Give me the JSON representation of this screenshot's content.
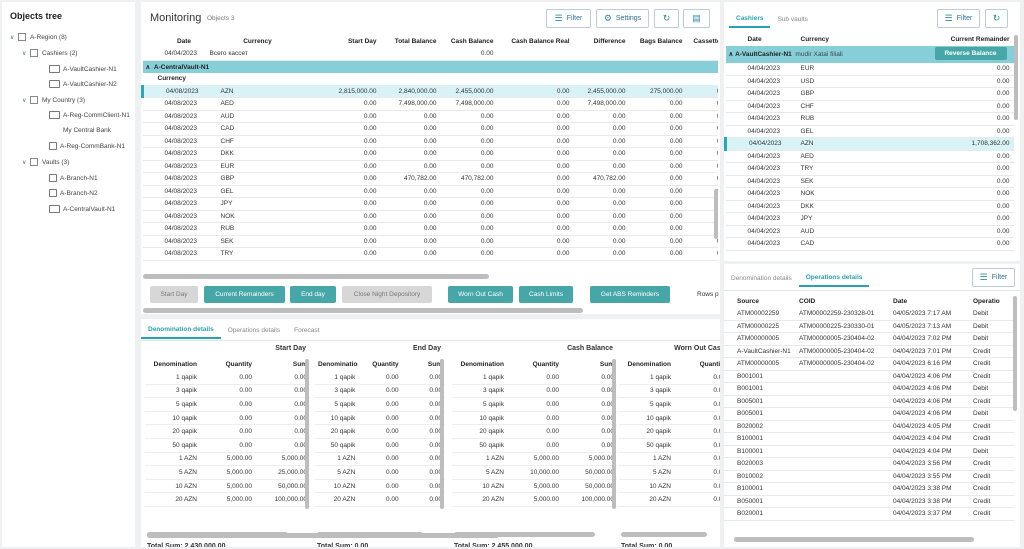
{
  "tree": {
    "title": "Objects tree",
    "nodes": [
      {
        "label": "A-Region (8)"
      },
      {
        "label": "Cashiers (2)"
      },
      {
        "label": "A-VaultCashier-N1"
      },
      {
        "label": "A-VaultCashier-N2"
      },
      {
        "label": "My Country (3)"
      },
      {
        "label": "A-Reg-CommClient-N1"
      },
      {
        "label": "My Central Bank"
      },
      {
        "label": "A-Reg-CommBank-N1"
      },
      {
        "label": "Vaults (3)"
      },
      {
        "label": "A-Branch-N1"
      },
      {
        "label": "A-Branch-N2"
      },
      {
        "label": "A-CentralVault-N1"
      }
    ]
  },
  "monitoring": {
    "title": "Monitoring",
    "subtitle": "Objects 3",
    "filter_label": "Filter",
    "settings_label": "Settings",
    "columns": [
      "Date",
      "Currency",
      "Start Day",
      "Total Balance",
      "Cash Balance",
      "Cash Balance Real",
      "Difference",
      "Bags Balance",
      "Cassette"
    ],
    "summary": {
      "date": "04/04/2023",
      "label": "Всего кассет",
      "cash_balance": "0.00"
    },
    "group_label": "A-CentralVault-N1",
    "sub_header": "Currency",
    "rows": [
      {
        "date": "04/08/2023",
        "currency": "AZN",
        "start": "2,815,000.00",
        "total": "2,840,000.00",
        "cash": "2,455,000.00",
        "real": "0.00",
        "diff": "2,455,000.00",
        "bags": "275,000.00",
        "cass": "0"
      },
      {
        "date": "04/08/2023",
        "currency": "AED",
        "start": "0.00",
        "total": "7,498,000.00",
        "cash": "7,498,000.00",
        "real": "0.00",
        "diff": "7,498,000.00",
        "bags": "0.00",
        "cass": "0"
      },
      {
        "date": "04/08/2023",
        "currency": "AUD",
        "start": "0.00",
        "total": "0.00",
        "cash": "0.00",
        "real": "0.00",
        "diff": "0.00",
        "bags": "0.00",
        "cass": "0"
      },
      {
        "date": "04/08/2023",
        "currency": "CAD",
        "start": "0.00",
        "total": "0.00",
        "cash": "0.00",
        "real": "0.00",
        "diff": "0.00",
        "bags": "0.00",
        "cass": "0"
      },
      {
        "date": "04/08/2023",
        "currency": "CHF",
        "start": "0.00",
        "total": "0.00",
        "cash": "0.00",
        "real": "0.00",
        "diff": "0.00",
        "bags": "0.00",
        "cass": "0"
      },
      {
        "date": "04/08/2023",
        "currency": "DKK",
        "start": "0.00",
        "total": "0.00",
        "cash": "0.00",
        "real": "0.00",
        "diff": "0.00",
        "bags": "0.00",
        "cass": "0"
      },
      {
        "date": "04/08/2023",
        "currency": "EUR",
        "start": "0.00",
        "total": "0.00",
        "cash": "0.00",
        "real": "0.00",
        "diff": "0.00",
        "bags": "0.00",
        "cass": "0"
      },
      {
        "date": "04/08/2023",
        "currency": "GBP",
        "start": "0.00",
        "total": "470,782.00",
        "cash": "470,782.00",
        "real": "0.00",
        "diff": "470,782.00",
        "bags": "0.00",
        "cass": "0"
      },
      {
        "date": "04/08/2023",
        "currency": "GEL",
        "start": "0.00",
        "total": "0.00",
        "cash": "0.00",
        "real": "0.00",
        "diff": "0.00",
        "bags": "0.00",
        "cass": "0"
      },
      {
        "date": "04/08/2023",
        "currency": "JPY",
        "start": "0.00",
        "total": "0.00",
        "cash": "0.00",
        "real": "0.00",
        "diff": "0.00",
        "bags": "0.00",
        "cass": "0"
      },
      {
        "date": "04/08/2023",
        "currency": "NOK",
        "start": "0.00",
        "total": "0.00",
        "cash": "0.00",
        "real": "0.00",
        "diff": "0.00",
        "bags": "0.00",
        "cass": "0"
      },
      {
        "date": "04/08/2023",
        "currency": "RUB",
        "start": "0.00",
        "total": "0.00",
        "cash": "0.00",
        "real": "0.00",
        "diff": "0.00",
        "bags": "0.00",
        "cass": "0"
      },
      {
        "date": "04/08/2023",
        "currency": "SEK",
        "start": "0.00",
        "total": "0.00",
        "cash": "0.00",
        "real": "0.00",
        "diff": "0.00",
        "bags": "0.00",
        "cass": "0"
      },
      {
        "date": "04/08/2023",
        "currency": "TRY",
        "start": "0.00",
        "total": "0.00",
        "cash": "0.00",
        "real": "0.00",
        "diff": "0.00",
        "bags": "0.00",
        "cass": "0"
      }
    ],
    "actions": [
      "Start Day",
      "Current Remainders",
      "End day",
      "Close Night Depository",
      "Worn Out Cash",
      "Cash Limits",
      "Get ABS Reminders"
    ],
    "rows_per_page_label": "Rows p"
  },
  "denomination": {
    "tabs": [
      "Denomination details",
      "Operations details",
      "Forecast"
    ],
    "col_headers": [
      "Denomination",
      "Quantity",
      "Sum"
    ],
    "blocks": [
      {
        "title": "Start Day",
        "total": "Total Sum: 2,430,000.00",
        "rows": [
          [
            "1 qapik",
            "0.00",
            "0.00"
          ],
          [
            "3 qapik",
            "0.00",
            "0.00"
          ],
          [
            "5 qapik",
            "0.00",
            "0.00"
          ],
          [
            "10 qapik",
            "0.00",
            "0.00"
          ],
          [
            "20 qapik",
            "0.00",
            "0.00"
          ],
          [
            "50 qapik",
            "0.00",
            "0.00"
          ],
          [
            "1 AZN",
            "5,000.00",
            "5,000.00"
          ],
          [
            "5 AZN",
            "5,000.00",
            "25,000.00"
          ],
          [
            "10 AZN",
            "5,000.00",
            "50,000.00"
          ],
          [
            "20 AZN",
            "5,000.00",
            "100,000.00"
          ]
        ]
      },
      {
        "title": "End Day",
        "total": "Total Sum: 0.00",
        "rows": [
          [
            "1 qapik",
            "0.00",
            "0.00"
          ],
          [
            "3 qapik",
            "0.00",
            "0.00"
          ],
          [
            "5 qapik",
            "0.00",
            "0.00"
          ],
          [
            "10 qapik",
            "0.00",
            "0.00"
          ],
          [
            "20 qapik",
            "0.00",
            "0.00"
          ],
          [
            "50 qapik",
            "0.00",
            "0.00"
          ],
          [
            "1 AZN",
            "0.00",
            "0.00"
          ],
          [
            "5 AZN",
            "0.00",
            "0.00"
          ],
          [
            "10 AZN",
            "0.00",
            "0.00"
          ],
          [
            "20 AZN",
            "0.00",
            "0.00"
          ]
        ]
      },
      {
        "title": "Cash Balance",
        "total": "Total Sum: 2,455,000.00",
        "rows": [
          [
            "1 qapik",
            "0.00",
            "0.00"
          ],
          [
            "3 qapik",
            "0.00",
            "0.00"
          ],
          [
            "5 qapik",
            "0.00",
            "0.00"
          ],
          [
            "10 qapik",
            "0.00",
            "0.00"
          ],
          [
            "20 qapik",
            "0.00",
            "0.00"
          ],
          [
            "50 qapik",
            "0.00",
            "0.00"
          ],
          [
            "1 AZN",
            "5,000.00",
            "5,000.00"
          ],
          [
            "5 AZN",
            "10,000.00",
            "50,000.00"
          ],
          [
            "10 AZN",
            "5,000.00",
            "50,000.00"
          ],
          [
            "20 AZN",
            "5,000.00",
            "100,000.00"
          ]
        ]
      },
      {
        "title": "Worn Out Cash",
        "total": "Total Sum: 0.00",
        "rows": [
          [
            "1 qapik",
            "0.00"
          ],
          [
            "3 qapik",
            "0.00"
          ],
          [
            "5 qapik",
            "0.00"
          ],
          [
            "10 qapik",
            "0.00"
          ],
          [
            "20 qapik",
            "0.00"
          ],
          [
            "50 qapik",
            "0.00"
          ],
          [
            "1 AZN",
            "0.00"
          ],
          [
            "5 AZN",
            "0.00"
          ],
          [
            "10 AZN",
            "0.00"
          ],
          [
            "20 AZN",
            "0.00"
          ]
        ]
      }
    ]
  },
  "cashiers": {
    "tabs": [
      "Cashiers",
      "Sub vaults"
    ],
    "filter_label": "Filter",
    "columns": [
      "Date",
      "Currency",
      "Current Remainder"
    ],
    "group_label": "A-VaultCashier-N1",
    "group_sub": "mudir Xatai filiali",
    "reverse_label": "Reverse Balance",
    "rows": [
      {
        "date": "04/04/2023",
        "currency": "EUR",
        "remainder": "0.00"
      },
      {
        "date": "04/04/2023",
        "currency": "USD",
        "remainder": "0.00"
      },
      {
        "date": "04/04/2023",
        "currency": "GBP",
        "remainder": "0.00"
      },
      {
        "date": "04/04/2023",
        "currency": "CHF",
        "remainder": "0.00"
      },
      {
        "date": "04/04/2023",
        "currency": "RUB",
        "remainder": "0.00"
      },
      {
        "date": "04/04/2023",
        "currency": "GEL",
        "remainder": "0.00"
      },
      {
        "date": "04/04/2023",
        "currency": "AZN",
        "remainder": "1,708,362.00"
      },
      {
        "date": "04/04/2023",
        "currency": "AED",
        "remainder": "0.00"
      },
      {
        "date": "04/04/2023",
        "currency": "TRY",
        "remainder": "0.00"
      },
      {
        "date": "04/04/2023",
        "currency": "SEK",
        "remainder": "0.00"
      },
      {
        "date": "04/04/2023",
        "currency": "NOK",
        "remainder": "0.00"
      },
      {
        "date": "04/04/2023",
        "currency": "DKK",
        "remainder": "0.00"
      },
      {
        "date": "04/04/2023",
        "currency": "JPY",
        "remainder": "0.00"
      },
      {
        "date": "04/04/2023",
        "currency": "AUD",
        "remainder": "0.00"
      },
      {
        "date": "04/04/2023",
        "currency": "CAD",
        "remainder": "0.00"
      }
    ]
  },
  "operations": {
    "tabs": [
      "Denomination details",
      "Operations details"
    ],
    "filter_label": "Filter",
    "columns": [
      "Source",
      "COID",
      "Date",
      "Operatio"
    ],
    "rows": [
      {
        "source": "ATM00002259",
        "coid": "ATM00002259-230328-01",
        "date": "04/05/2023 7:17 AM",
        "op": "Debit"
      },
      {
        "source": "ATM00000225",
        "coid": "ATM00000225-230330-01",
        "date": "04/05/2023 7:13 AM",
        "op": "Debit"
      },
      {
        "source": "ATM00000005",
        "coid": "ATM00000005-230404-02",
        "date": "04/04/2023 7:02 PM",
        "op": "Debit"
      },
      {
        "source": "A-VaultCashier-N1",
        "coid": "ATM00000005-230404-02",
        "date": "04/04/2023 7:01 PM",
        "op": "Credit"
      },
      {
        "source": "ATM00000005",
        "coid": "ATM00000005-230404-02",
        "date": "04/04/2023 6:16 PM",
        "op": "Credit"
      },
      {
        "source": "B001001",
        "coid": "",
        "date": "04/04/2023 4:06 PM",
        "op": "Credit"
      },
      {
        "source": "B001001",
        "coid": "",
        "date": "04/04/2023 4:06 PM",
        "op": "Debit"
      },
      {
        "source": "B005001",
        "coid": "",
        "date": "04/04/2023 4:06 PM",
        "op": "Credit"
      },
      {
        "source": "B005001",
        "coid": "",
        "date": "04/04/2023 4:06 PM",
        "op": "Debit"
      },
      {
        "source": "B020002",
        "coid": "",
        "date": "04/04/2023 4:05 PM",
        "op": "Credit"
      },
      {
        "source": "B100001",
        "coid": "",
        "date": "04/04/2023 4:04 PM",
        "op": "Credit"
      },
      {
        "source": "B100001",
        "coid": "",
        "date": "04/04/2023 4:04 PM",
        "op": "Debit"
      },
      {
        "source": "B020003",
        "coid": "",
        "date": "04/04/2023 3:56 PM",
        "op": "Credit"
      },
      {
        "source": "B010002",
        "coid": "",
        "date": "04/04/2023 3:55 PM",
        "op": "Credit"
      },
      {
        "source": "B100001",
        "coid": "",
        "date": "04/04/2023 3:38 PM",
        "op": "Credit"
      },
      {
        "source": "B050001",
        "coid": "",
        "date": "04/04/2023 3:38 PM",
        "op": "Credit"
      },
      {
        "source": "B020001",
        "coid": "",
        "date": "04/04/2023 3:37 PM",
        "op": "Credit"
      }
    ]
  }
}
